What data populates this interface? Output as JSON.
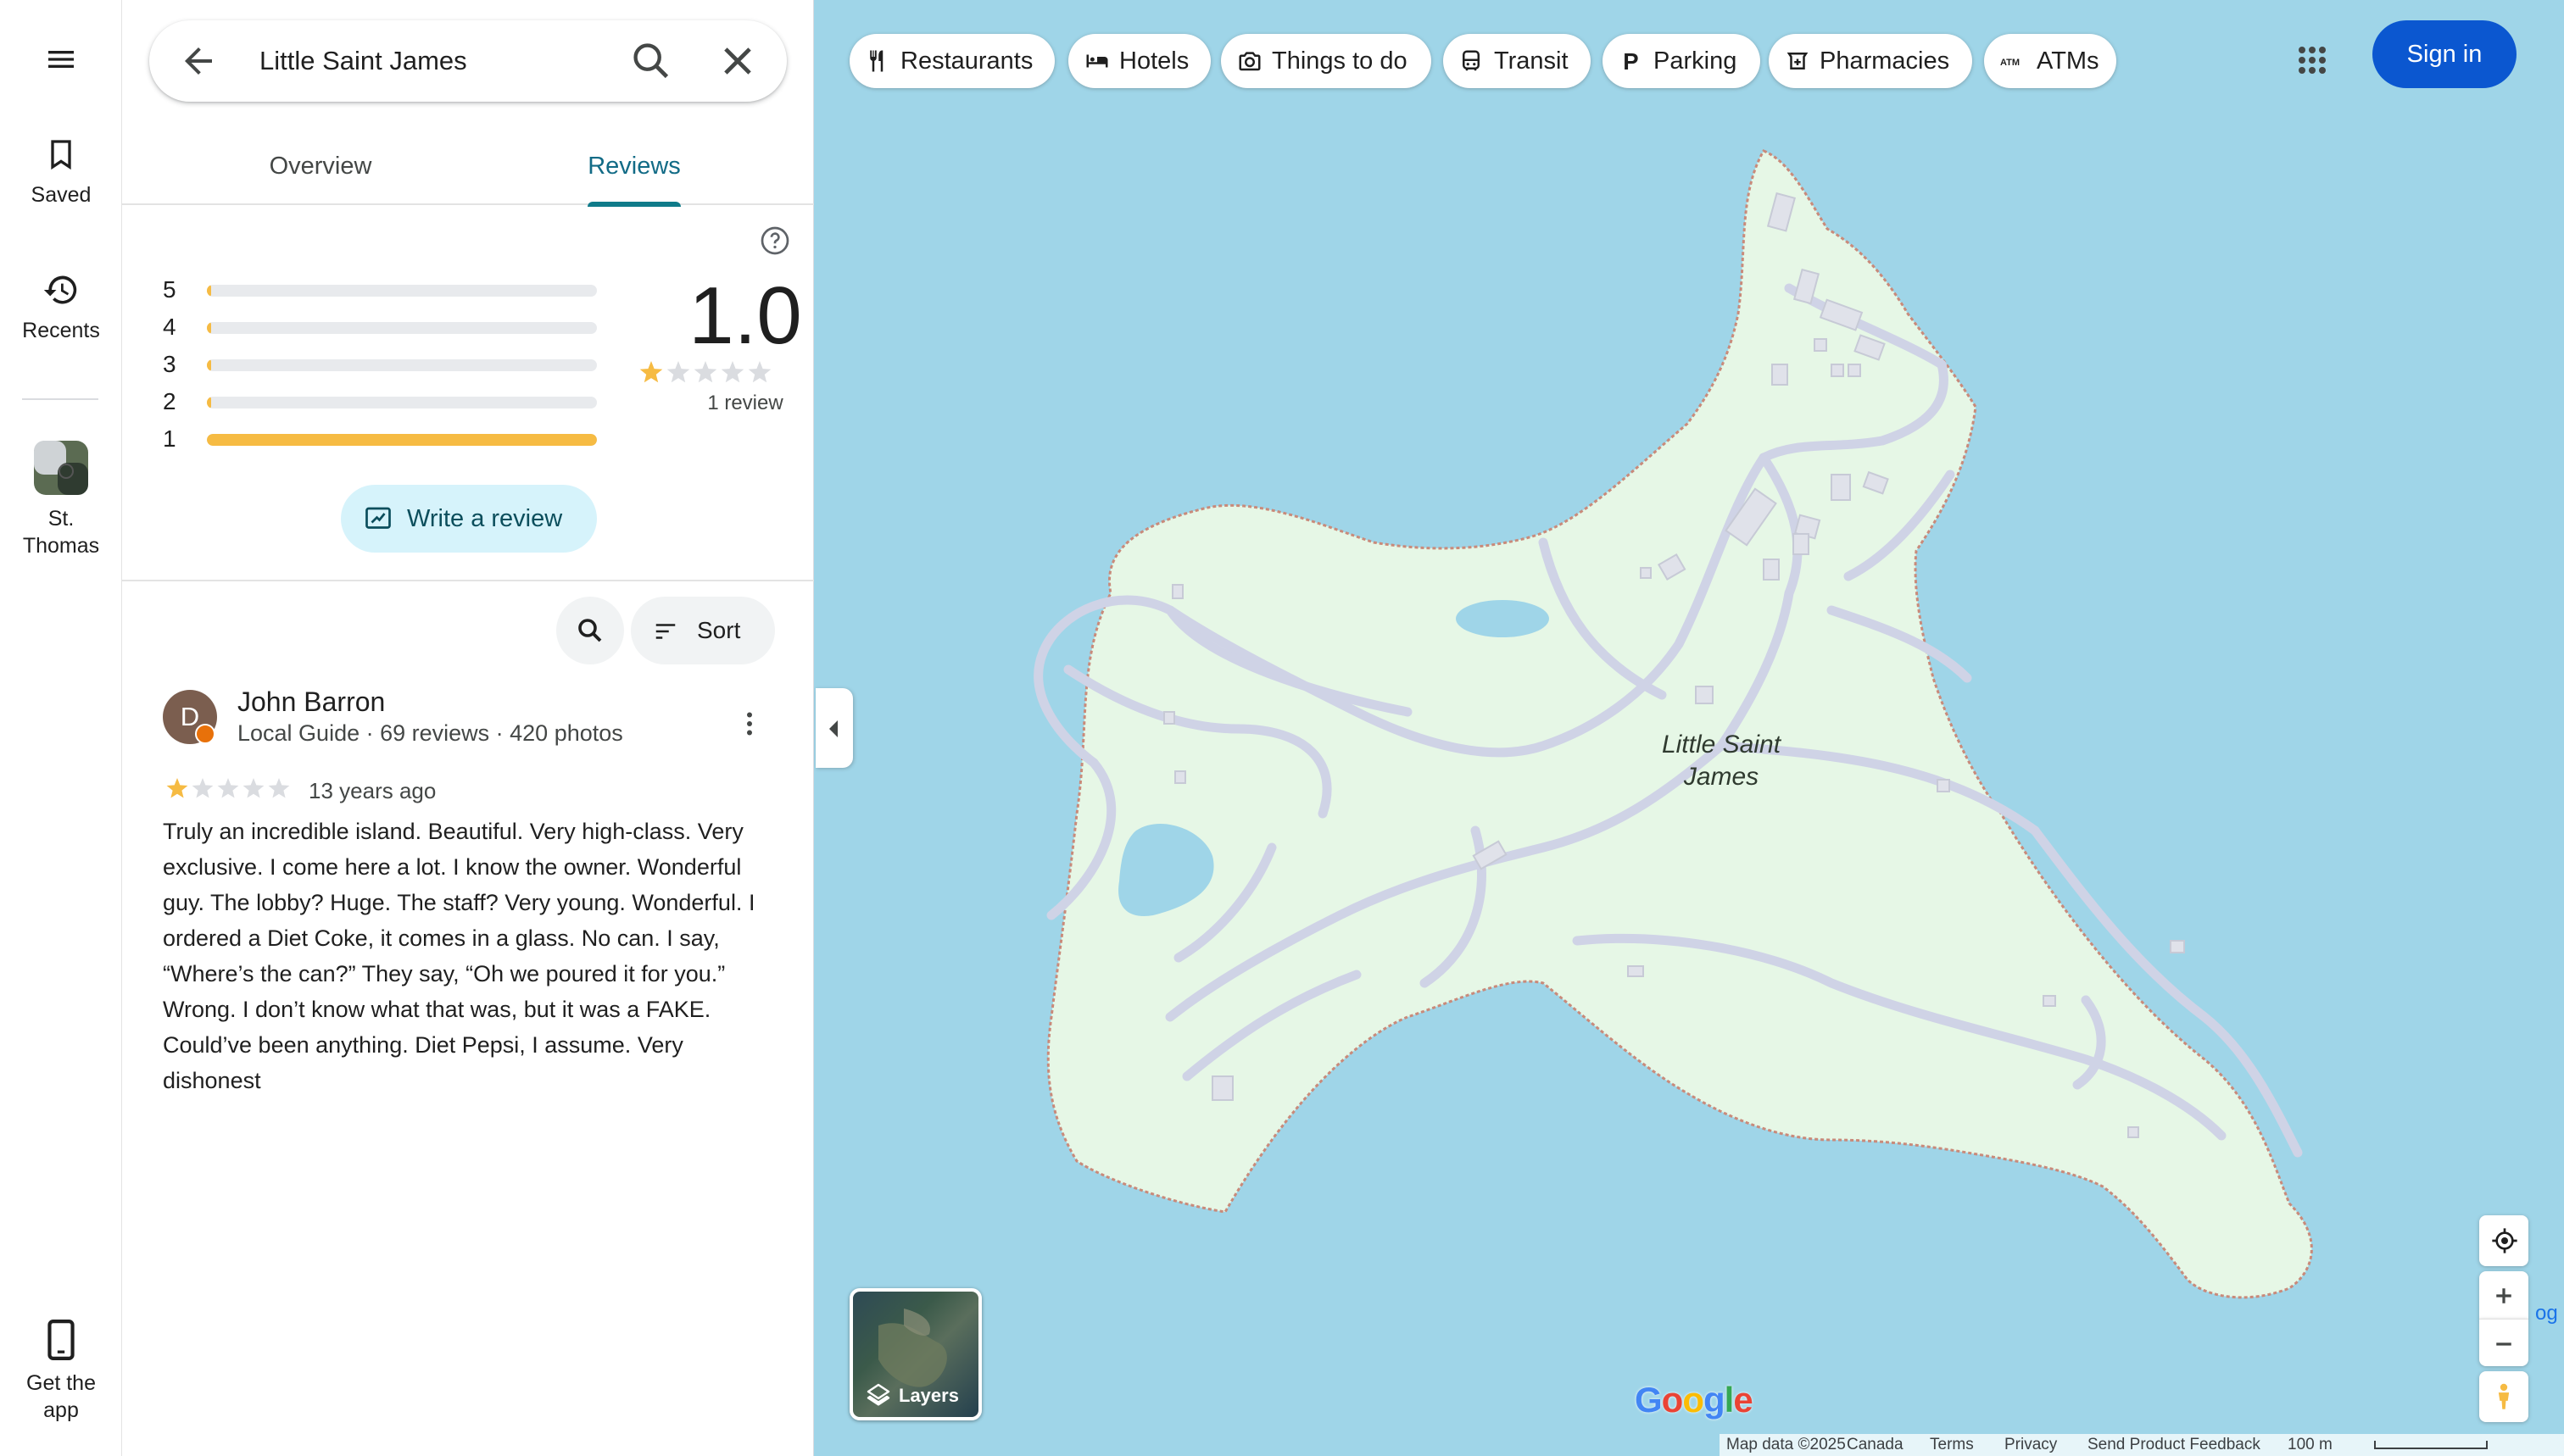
{
  "rail": {
    "saved": "Saved",
    "recents": "Recents",
    "recent_place_line1": "St.",
    "recent_place_line2": "Thomas",
    "get_app_line1": "Get the",
    "get_app_line2": "app"
  },
  "search": {
    "query": "Little Saint James"
  },
  "tabs": [
    {
      "label": "Overview",
      "active": false
    },
    {
      "label": "Reviews",
      "active": true
    }
  ],
  "rating": {
    "value": "1.0",
    "count_label": "1 review",
    "stars_filled": 1,
    "histogram": [
      {
        "label": "5",
        "fraction": 0.01
      },
      {
        "label": "4",
        "fraction": 0.01
      },
      {
        "label": "3",
        "fraction": 0.01
      },
      {
        "label": "2",
        "fraction": 0.01
      },
      {
        "label": "1",
        "fraction": 1.0
      }
    ],
    "write_review_label": "Write a review"
  },
  "toolbar": {
    "sort_label": "Sort"
  },
  "review": {
    "avatar_letter": "D",
    "author": "John Barron",
    "meta": "Local Guide · 69 reviews · 420 photos",
    "stars_filled": 1,
    "date": "13 years ago",
    "text": "Truly an incredible island. Beautiful. Very high-class. Very exclusive. I come here a lot. I know the owner. Wonderful guy. The lobby? Huge. The staff?  Very young. Wonderful. I ordered a Diet Coke, it comes in a glass. No can. I say, “Where’s the can?” They say, “Oh we poured it for you.” Wrong. I don’t know what that was, but it was a FAKE. Could’ve been anything. Diet Pepsi, I assume. Very dishonest"
  },
  "chips": [
    {
      "label": "Restaurants",
      "icon": "fork-knife-icon"
    },
    {
      "label": "Hotels",
      "icon": "bed-icon"
    },
    {
      "label": "Things to do",
      "icon": "camera-icon"
    },
    {
      "label": "Transit",
      "icon": "bus-icon"
    },
    {
      "label": "Parking",
      "icon": "parking-icon"
    },
    {
      "label": "Pharmacies",
      "icon": "pharmacy-icon"
    },
    {
      "label": "ATMs",
      "icon": "atm-icon"
    }
  ],
  "atm_glyph": "ATM",
  "parking_glyph": "P",
  "sign_in_label": "Sign in",
  "map": {
    "place_label_line1": "Little Saint",
    "place_label_line2": "James",
    "layers_label": "Layers",
    "edge_text": "og",
    "logo": [
      "G",
      "o",
      "o",
      "g",
      "l",
      "e"
    ],
    "logo_colors": [
      "#4285f4",
      "#ea4335",
      "#fbbc05",
      "#4285f4",
      "#34a853",
      "#ea4335"
    ],
    "attribution": {
      "map_data": "Map data ©2025",
      "region": "Canada",
      "terms": "Terms",
      "privacy": "Privacy",
      "feedback": "Send Product Feedback",
      "scale": "100 m"
    }
  },
  "colors": {
    "water": "#9fd5e8",
    "land": "#e6f7e6",
    "road": "#cfd3e6",
    "accent": "#0b57d0",
    "star": "#f6bb43"
  }
}
